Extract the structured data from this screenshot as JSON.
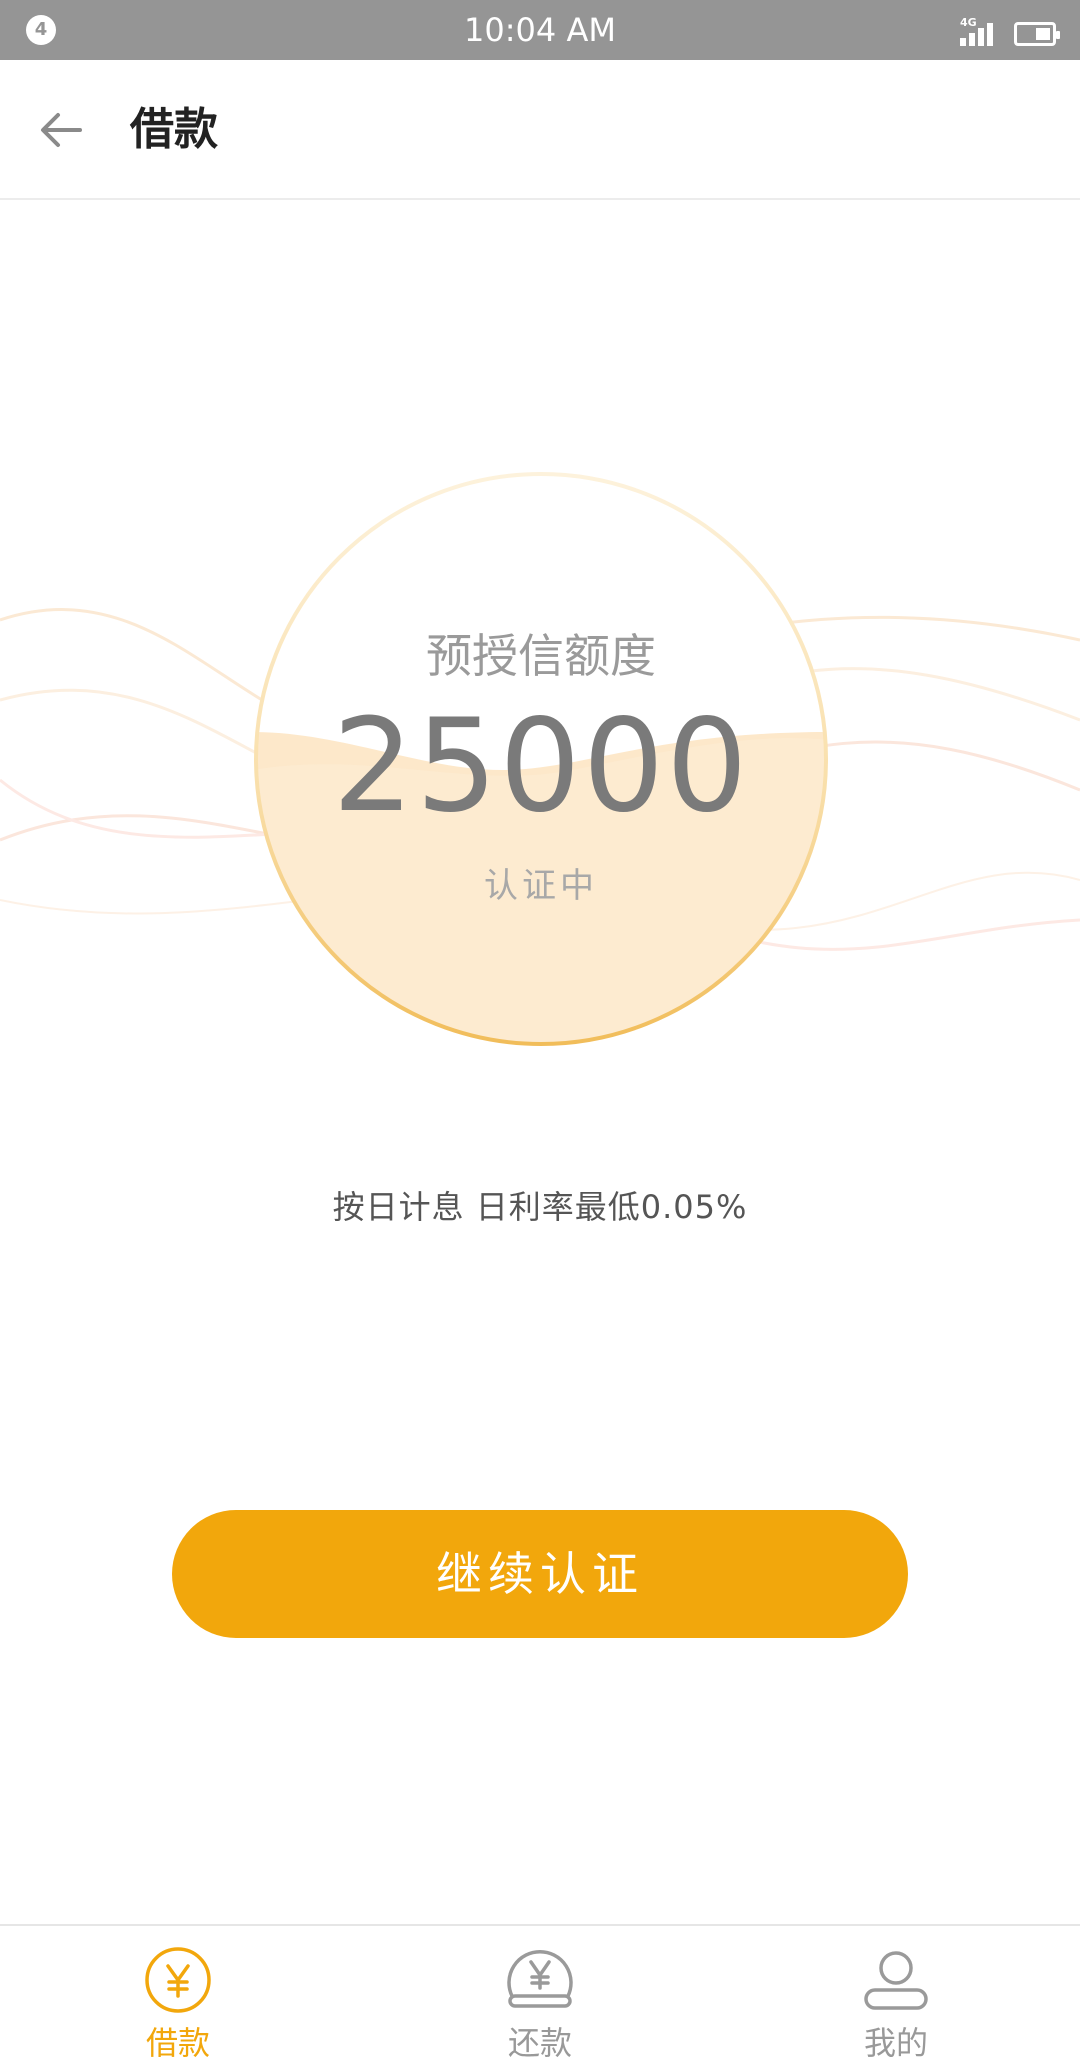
{
  "status_bar": {
    "notification_count": "4",
    "time": "10:04 AM",
    "network": "4G"
  },
  "header": {
    "title": "借款"
  },
  "credit": {
    "label": "预授信额度",
    "amount": "25000",
    "status": "认证中"
  },
  "interest_note": "按日计息 日利率最低0.05%",
  "primary_button": "继续认证",
  "tabs": [
    {
      "label": "借款",
      "icon": "yuan-coin-icon",
      "active": true
    },
    {
      "label": "还款",
      "icon": "repay-coin-icon",
      "active": false
    },
    {
      "label": "我的",
      "icon": "user-icon",
      "active": false
    }
  ],
  "colors": {
    "accent": "#f2a70c",
    "status_bar": "#959595",
    "inactive_tab": "#999999"
  }
}
